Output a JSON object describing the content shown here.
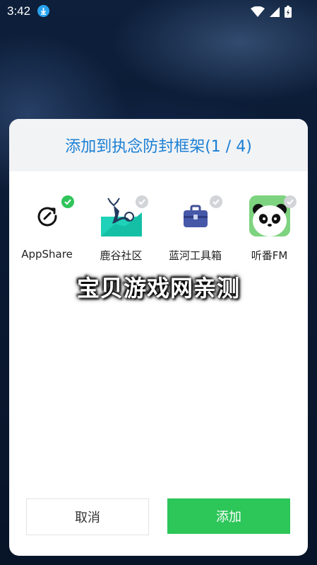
{
  "status_bar": {
    "time": "3:42"
  },
  "dialog": {
    "title": "添加到执念防封框架(1 / 4)",
    "apps": [
      {
        "label": "AppShare",
        "checked": true,
        "icon": "appshare-icon"
      },
      {
        "label": "鹿谷社区",
        "checked": false,
        "icon": "lugu-icon"
      },
      {
        "label": "蓝河工具箱",
        "checked": false,
        "icon": "toolbox-icon"
      },
      {
        "label": "听番FM",
        "checked": false,
        "icon": "panda-icon"
      }
    ],
    "cancel_label": "取消",
    "add_label": "添加"
  },
  "watermark": "宝贝游戏网亲测",
  "colors": {
    "title": "#1a7fd4",
    "add_button": "#2dc659",
    "check_on": "#2fc45a",
    "check_off": "#d2d4d8"
  }
}
